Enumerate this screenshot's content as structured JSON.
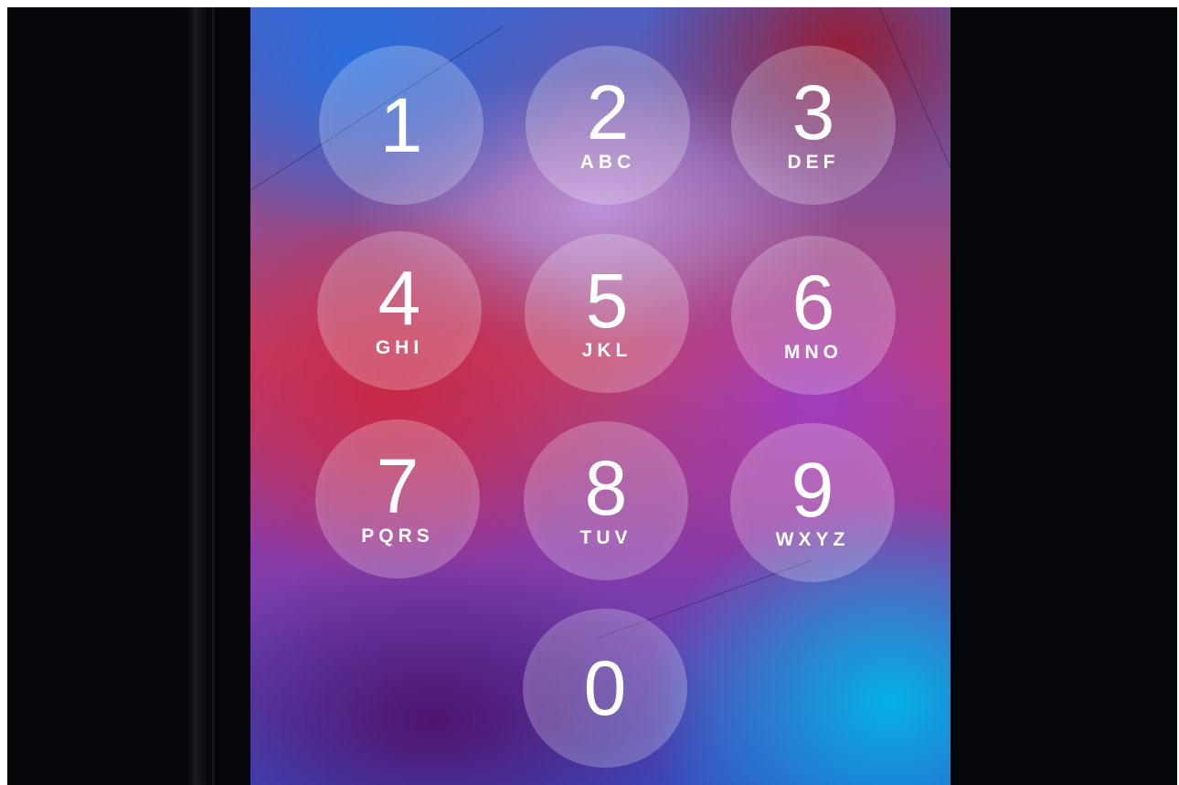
{
  "keypad": {
    "keys": [
      {
        "digit": "1",
        "letters": ""
      },
      {
        "digit": "2",
        "letters": "ABC"
      },
      {
        "digit": "3",
        "letters": "DEF"
      },
      {
        "digit": "4",
        "letters": "GHI"
      },
      {
        "digit": "5",
        "letters": "JKL"
      },
      {
        "digit": "6",
        "letters": "MNO"
      },
      {
        "digit": "7",
        "letters": "PQRS"
      },
      {
        "digit": "8",
        "letters": "TUV"
      },
      {
        "digit": "9",
        "letters": "WXYZ"
      },
      {
        "digit": "0",
        "letters": ""
      }
    ]
  },
  "colors": {
    "key_overlay": "rgba(255,255,255,0.22)",
    "text": "#ffffff",
    "bezel": "#05060b"
  }
}
